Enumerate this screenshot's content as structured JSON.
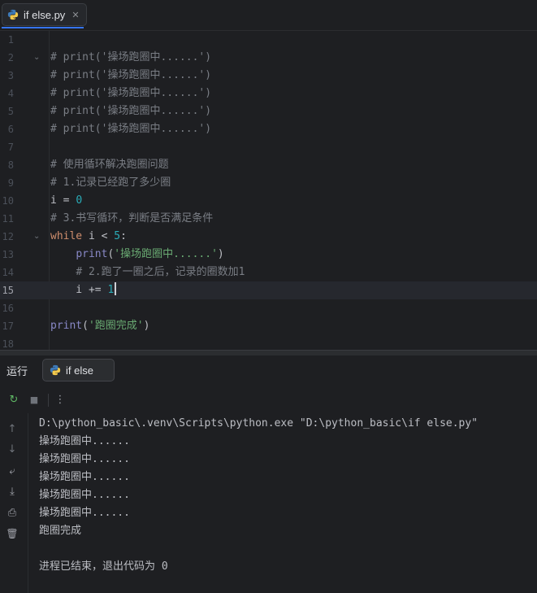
{
  "editor_tab": {
    "label": "if else.py",
    "close_glyph": "✕",
    "icon": "python-file-icon"
  },
  "editor": {
    "current_line": 15,
    "lines": [
      {
        "n": "1",
        "fold": "",
        "tokens": []
      },
      {
        "n": "2",
        "fold": "⌄",
        "tokens": [
          {
            "t": "# print('操场跑圈中......')",
            "c": "c-comment"
          }
        ]
      },
      {
        "n": "3",
        "fold": "",
        "tokens": [
          {
            "t": "# print('操场跑圈中......')",
            "c": "c-comment"
          }
        ]
      },
      {
        "n": "4",
        "fold": "",
        "tokens": [
          {
            "t": "# print('操场跑圈中......')",
            "c": "c-comment"
          }
        ]
      },
      {
        "n": "5",
        "fold": "",
        "tokens": [
          {
            "t": "# print('操场跑圈中......')",
            "c": "c-comment"
          }
        ]
      },
      {
        "n": "6",
        "fold": "",
        "tokens": [
          {
            "t": "# print('操场跑圈中......')",
            "c": "c-comment"
          }
        ]
      },
      {
        "n": "7",
        "fold": "",
        "tokens": []
      },
      {
        "n": "8",
        "fold": "",
        "tokens": [
          {
            "t": "# 使用循环解决跑圈问题",
            "c": "c-comment"
          }
        ]
      },
      {
        "n": "9",
        "fold": "",
        "tokens": [
          {
            "t": "# 1.记录已经跑了多少圈",
            "c": "c-comment"
          }
        ]
      },
      {
        "n": "10",
        "fold": "",
        "tokens": [
          {
            "t": "i",
            "c": "c-id"
          },
          {
            "t": " = ",
            "c": "c-id"
          },
          {
            "t": "0",
            "c": "c-num"
          }
        ]
      },
      {
        "n": "11",
        "fold": "",
        "tokens": [
          {
            "t": "# 3.书写循环，判断是否满足条件",
            "c": "c-comment"
          }
        ]
      },
      {
        "n": "12",
        "fold": "⌄",
        "tokens": [
          {
            "t": "while",
            "c": "c-kw"
          },
          {
            "t": " i < ",
            "c": "c-id"
          },
          {
            "t": "5",
            "c": "c-num"
          },
          {
            "t": ":",
            "c": "c-id"
          }
        ]
      },
      {
        "n": "13",
        "fold": "",
        "tokens": [
          {
            "t": "    ",
            "c": "c-id"
          },
          {
            "t": "print",
            "c": "c-fn"
          },
          {
            "t": "(",
            "c": "c-id"
          },
          {
            "t": "'操场跑圈中......'",
            "c": "c-str"
          },
          {
            "t": ")",
            "c": "c-id"
          }
        ]
      },
      {
        "n": "14",
        "fold": "",
        "tokens": [
          {
            "t": "    ",
            "c": "c-id"
          },
          {
            "t": "# 2.跑了一圈之后，记录的圈数加1",
            "c": "c-comment"
          }
        ]
      },
      {
        "n": "15",
        "fold": "",
        "tokens": [
          {
            "t": "    i += ",
            "c": "c-id"
          },
          {
            "t": "1",
            "c": "c-num"
          }
        ]
      },
      {
        "n": "16",
        "fold": "",
        "tokens": []
      },
      {
        "n": "17",
        "fold": "",
        "tokens": [
          {
            "t": "print",
            "c": "c-fn"
          },
          {
            "t": "(",
            "c": "c-id"
          },
          {
            "t": "'跑圈完成'",
            "c": "c-str"
          },
          {
            "t": ")",
            "c": "c-id"
          }
        ]
      },
      {
        "n": "18",
        "fold": "",
        "tokens": []
      }
    ]
  },
  "run_panel": {
    "title": "运行",
    "tab_label": "if else",
    "toolbar": [
      {
        "name": "rerun-icon",
        "glyph": "↻"
      },
      {
        "name": "stop-icon",
        "glyph": "■"
      },
      {
        "name": "more-options-icon",
        "glyph": "⋮"
      }
    ],
    "sidebar": [
      {
        "name": "scroll-up-icon",
        "glyph": "↑"
      },
      {
        "name": "scroll-down-icon",
        "glyph": "↓"
      },
      {
        "name": "soft-wrap-icon",
        "glyph": "⤶"
      },
      {
        "name": "scroll-to-end-icon",
        "glyph": "⤓"
      },
      {
        "name": "print-icon",
        "glyph": "⎙"
      },
      {
        "name": "trash-icon",
        "glyph": "🗑"
      }
    ],
    "console_lines": [
      "D:\\python_basic\\.venv\\Scripts\\python.exe \"D:\\python_basic\\if else.py\"",
      "操场跑圈中......",
      "操场跑圈中......",
      "操场跑圈中......",
      "操场跑圈中......",
      "操场跑圈中......",
      "跑圈完成",
      "",
      "进程已结束，退出代码为 0"
    ]
  },
  "colors": {
    "accent": "#3574f0",
    "background": "#1e1f22",
    "comment": "#7a7e85",
    "keyword": "#cf8e6d",
    "string": "#6aab73",
    "number": "#2aacb8",
    "builtin": "#8888c6"
  }
}
